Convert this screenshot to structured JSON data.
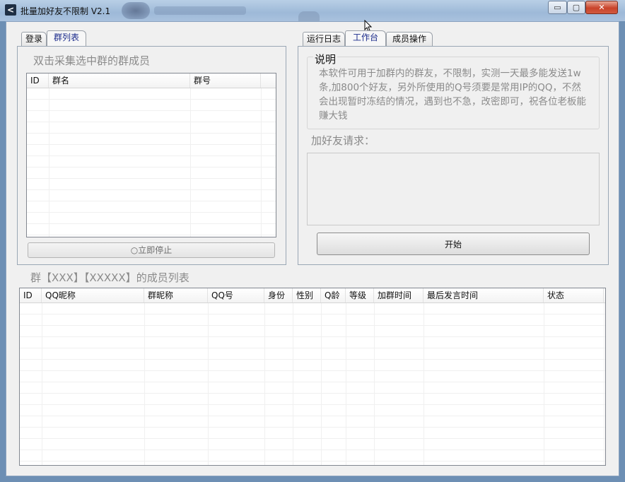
{
  "window": {
    "title": "批量加好友不限制 V2.1",
    "icon": "back-arrow-icon",
    "controls": {
      "minimize": "▭",
      "maximize": "▢",
      "close": "✕"
    }
  },
  "left_tabs": [
    {
      "label": "登录",
      "active": false
    },
    {
      "label": "群列表",
      "active": true
    }
  ],
  "group_list": {
    "title": "双击采集选中群的群成员",
    "columns": [
      "ID",
      "群名",
      "群号"
    ],
    "rows": [],
    "stop_button": "○立即停止"
  },
  "right_tabs": [
    {
      "label": "运行日志",
      "active": false
    },
    {
      "label": "工作台",
      "active": true
    },
    {
      "label": "成员操作",
      "active": false
    }
  ],
  "workbench": {
    "note_title": "说明",
    "note_text": "本软件可用于加群内的群友，不限制，实测一天最多能发送1w条,加800个好友，另外所使用的Q号须要是常用IP的QQ，不然会出现暂时冻结的情况，遇到也不急，改密即可，祝各位老板能赚大钱",
    "request_label": "加好友请求：",
    "request_value": "",
    "start_button": "开始"
  },
  "member_list": {
    "title": "群【XXX】【XXXXX】的成员列表",
    "columns": [
      "ID",
      "QQ昵称",
      "群昵称",
      "QQ号",
      "身份",
      "性别",
      "Q龄",
      "等级",
      "加群时间",
      "最后发言时间",
      "状态"
    ],
    "rows": []
  }
}
